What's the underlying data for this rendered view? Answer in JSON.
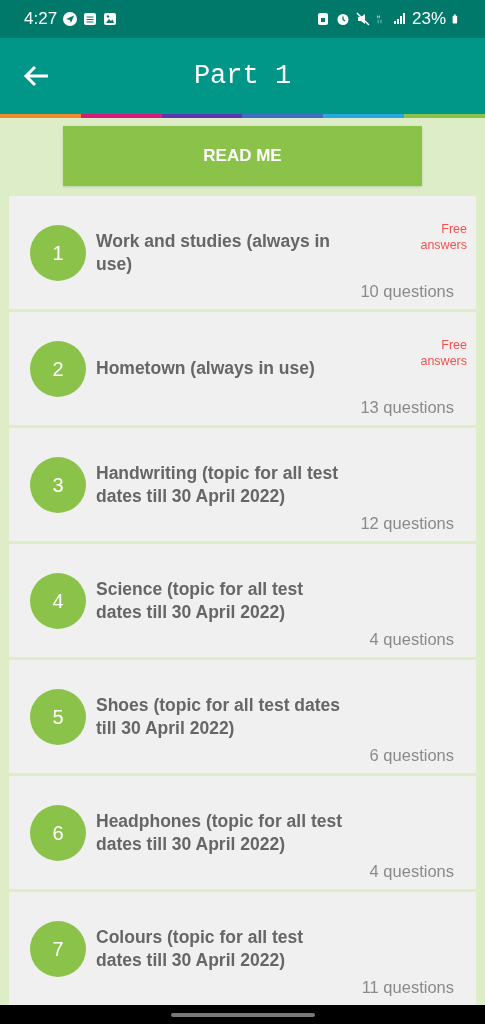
{
  "status_bar": {
    "time": "4:27",
    "battery": "23%"
  },
  "header": {
    "title": "Part 1"
  },
  "read_me_button": "READ ME",
  "topics": [
    {
      "number": "1",
      "title": "Work and studies (always in use)",
      "count": "10 questions",
      "badge": "Free answers"
    },
    {
      "number": "2",
      "title": "Hometown (always in use)",
      "count": "13 questions",
      "badge": "Free answers"
    },
    {
      "number": "3",
      "title": "Handwriting (topic for all test dates till 30 April 2022)",
      "count": "12 questions"
    },
    {
      "number": "4",
      "title": "Science (topic for all test dates till 30 April 2022)",
      "count": "4 questions"
    },
    {
      "number": "5",
      "title": "Shoes (topic for all test dates till 30 April 2022)",
      "count": "6 questions"
    },
    {
      "number": "6",
      "title": "Headphones (topic for all test dates till 30 April 2022)",
      "count": "4 questions"
    },
    {
      "number": "7",
      "title": "Colours (topic for all test dates till 30 April 2022)",
      "count": "11 questions"
    }
  ]
}
